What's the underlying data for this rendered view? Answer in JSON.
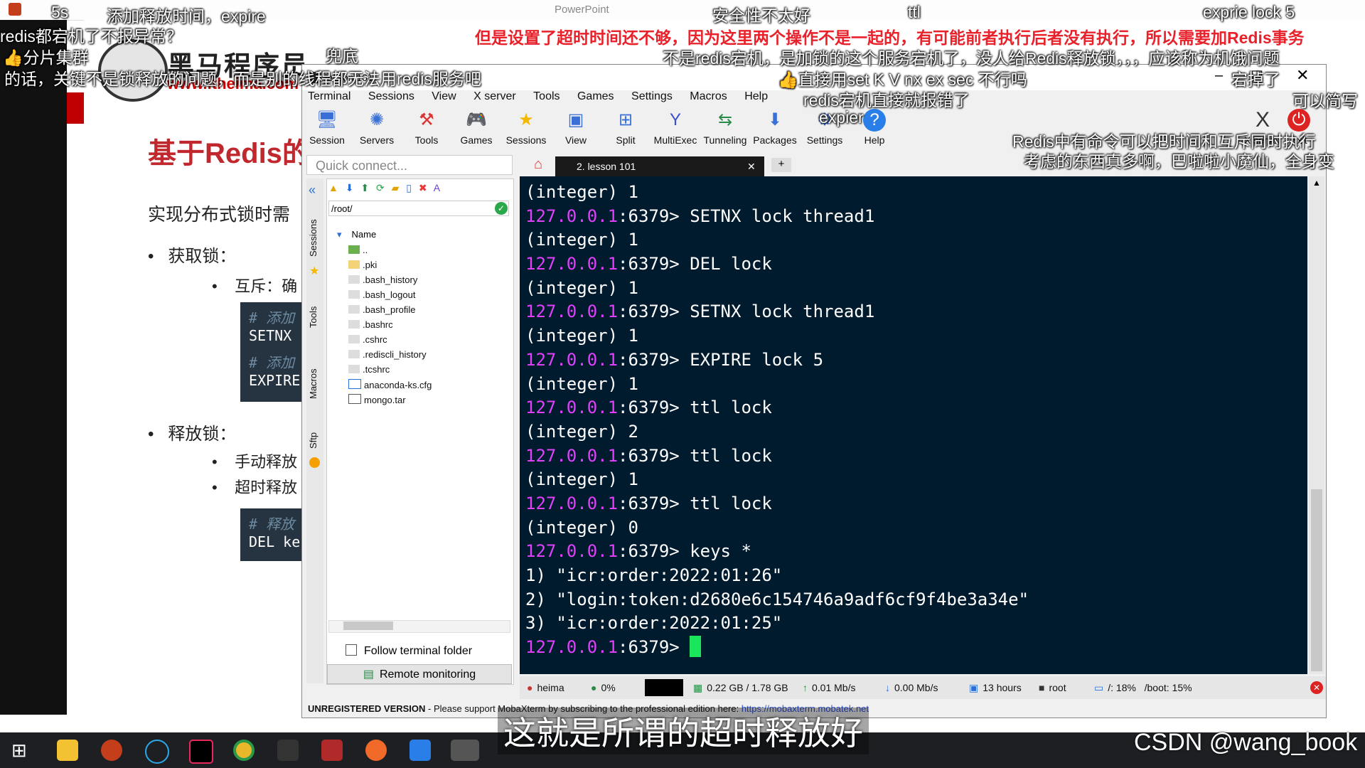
{
  "ppt": {
    "title": "PowerPoint",
    "logo_text": "黑马程序员",
    "logo_url": "www.itheima.com",
    "slide_title": "基于Redis的",
    "intro": "实现分布式锁时需",
    "acquire_label": "获取锁：",
    "acquire_sub": "互斥：确",
    "code1_comment": "# 添加",
    "code1_cmd": "SETNX",
    "code2_comment": "# 添加",
    "code2_cmd": "EXPIRE",
    "release_label": "释放锁：",
    "release_sub1": "手动释放",
    "release_sub2": "超时释放",
    "code3_comment": "# 释放",
    "code3_cmd": "DEL ke"
  },
  "danmaku": {
    "d1": "5s",
    "d2": "添加释放时间，expire",
    "d3": "安全性不太好",
    "d4": "ttl",
    "d5": "exprie lock 5",
    "d6": "redis都宕机了不报异常？",
    "d7": "但是设置了超时时间还不够，因为这里两个操作不是一起的，有可能前者执行后者没有执行，所以需要加Redis事务",
    "d8": "分片集群",
    "d9": "兜底",
    "d10": "不是redis宕机，是加锁的这个服务宕机了，没人给Redis释放锁，，，应该称为机饿问题",
    "d11": "的话，关键不是锁释放的问题，而是别的线程都无法用redis服务吧",
    "d12": "直接用set K V nx ex sec 不行吗",
    "d13": "宕掉了",
    "d14": "redis宕机直接就报错了",
    "d15": "可以简写",
    "d16": "expier",
    "d17": "Redis中有命令可以把时间和互斥同时执行",
    "d18": "考虑的东西真多啊，巴啦啦小魔仙，全身变"
  },
  "moba": {
    "window_title": "lesson 101",
    "menu": [
      "Terminal",
      "Sessions",
      "View",
      "X server",
      "Tools",
      "Games",
      "Settings",
      "Macros",
      "Help"
    ],
    "toolbar": [
      "Session",
      "Servers",
      "Tools",
      "Games",
      "Sessions",
      "View",
      "Split",
      "MultiExec",
      "Tunneling",
      "Packages",
      "Settings",
      "Help"
    ],
    "xserver_label": "X server",
    "exit_label": "Exit",
    "quick_connect": "Quick connect...",
    "side_tabs": [
      "Sessions",
      "Tools",
      "Macros",
      "Sftp"
    ],
    "path": "/root/",
    "name_header": "Name",
    "files": [
      "..",
      ".pki",
      ".bash_history",
      ".bash_logout",
      ".bash_profile",
      ".bashrc",
      ".cshrc",
      ".rediscli_history",
      ".tcshrc",
      "anaconda-ks.cfg",
      "mongo.tar"
    ],
    "follow_terminal": "Follow terminal folder",
    "remote_monitoring": "Remote monitoring",
    "tab_label": "2. lesson 101",
    "terminal": [
      {
        "prompt": "",
        "text": "(integer) 1"
      },
      {
        "prompt": "127.0.0.1",
        "text": ":6379> SETNX lock thread1"
      },
      {
        "prompt": "",
        "text": "(integer) 1"
      },
      {
        "prompt": "127.0.0.1",
        "text": ":6379> DEL lock"
      },
      {
        "prompt": "",
        "text": "(integer) 1"
      },
      {
        "prompt": "127.0.0.1",
        "text": ":6379> SETNX lock thread1"
      },
      {
        "prompt": "",
        "text": "(integer) 1"
      },
      {
        "prompt": "127.0.0.1",
        "text": ":6379> EXPIRE lock 5"
      },
      {
        "prompt": "",
        "text": "(integer) 1"
      },
      {
        "prompt": "127.0.0.1",
        "text": ":6379> ttl lock"
      },
      {
        "prompt": "",
        "text": "(integer) 2"
      },
      {
        "prompt": "127.0.0.1",
        "text": ":6379> ttl lock"
      },
      {
        "prompt": "",
        "text": "(integer) 1"
      },
      {
        "prompt": "127.0.0.1",
        "text": ":6379> ttl lock"
      },
      {
        "prompt": "",
        "text": "(integer) 0"
      },
      {
        "prompt": "127.0.0.1",
        "text": ":6379> keys *"
      },
      {
        "prompt": "",
        "text": "1) \"icr:order:2022:01:26\""
      },
      {
        "prompt": "",
        "text": "2) \"login:token:d2680e6c154746a9adf6cf9f4be3a34e\""
      },
      {
        "prompt": "",
        "text": "3) \"icr:order:2022:01:25\""
      },
      {
        "prompt": "127.0.0.1",
        "text": ":6379> "
      }
    ],
    "status": {
      "host": "heima",
      "cpu": "0%",
      "mem": "0.22 GB / 1.78 GB",
      "up": "0.01 Mb/s",
      "down": "0.00 Mb/s",
      "uptime": "13 hours",
      "user": "root",
      "disk1": "/: 18%",
      "disk2": "/boot: 15%"
    },
    "unregistered": "UNREGISTERED VERSION",
    "support_text": " -  Please support MobaXterm by subscribing to the professional edition here: ",
    "support_link": "https://mobaxterm.mobatek.net"
  },
  "subtitle": "这就是所谓的超时释放好",
  "watermark": "CSDN @wang_book",
  "colors": {
    "terminal_bg": "#001b2e",
    "prompt": "#e040fb",
    "cursor": "#19e65a",
    "slide_title": "#c0282d"
  }
}
